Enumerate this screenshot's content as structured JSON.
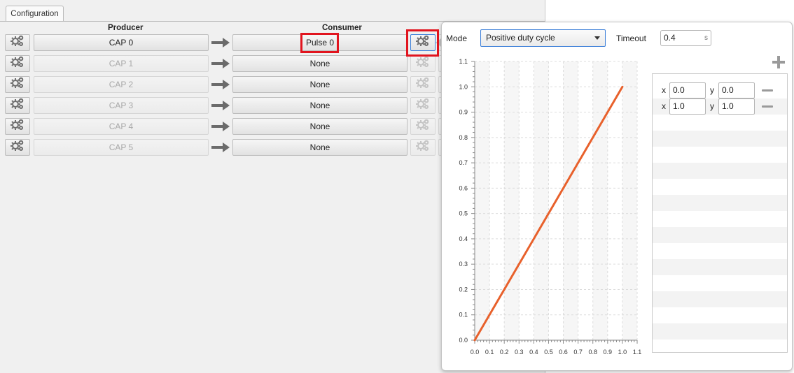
{
  "tab": {
    "label": "Configuration"
  },
  "headers": {
    "producer": "Producer",
    "consumer": "Consumer"
  },
  "rows": [
    {
      "producer": "CAP 0",
      "consumer": "Pulse 0",
      "producer_enabled": true
    },
    {
      "producer": "CAP 1",
      "consumer": "None",
      "producer_enabled": false
    },
    {
      "producer": "CAP 2",
      "consumer": "None",
      "producer_enabled": false
    },
    {
      "producer": "CAP 3",
      "consumer": "None",
      "producer_enabled": false
    },
    {
      "producer": "CAP 4",
      "consumer": "None",
      "producer_enabled": false
    },
    {
      "producer": "CAP 5",
      "consumer": "None",
      "producer_enabled": false
    }
  ],
  "popup": {
    "mode_label": "Mode",
    "mode_value": "Positive duty cycle",
    "timeout_label": "Timeout",
    "timeout_value": "0.4",
    "timeout_unit": "s",
    "points": [
      {
        "x_label": "x",
        "x": "0.0",
        "y_label": "y",
        "y": "0.0"
      },
      {
        "x_label": "x",
        "x": "1.0",
        "y_label": "y",
        "y": "1.0"
      }
    ]
  },
  "chart_data": {
    "type": "line",
    "x": [
      0.0,
      1.0
    ],
    "series": [
      {
        "values": [
          0.0,
          1.0
        ],
        "color": "#e8612c"
      }
    ],
    "xlim": [
      0.0,
      1.1
    ],
    "ylim": [
      0.0,
      1.1
    ],
    "xticks": [
      "0.0",
      "0.1",
      "0.2",
      "0.3",
      "0.4",
      "0.5",
      "0.6",
      "0.7",
      "0.8",
      "0.9",
      "1.0",
      "1.1"
    ],
    "yticks": [
      "0.0",
      "0.1",
      "0.2",
      "0.3",
      "0.4",
      "0.5",
      "0.6",
      "0.7",
      "0.8",
      "0.9",
      "1.0",
      "1.1"
    ],
    "grid": true
  },
  "colors": {
    "highlight": "#e1141e",
    "line": "#e8612c",
    "select_border": "#3c7fd8"
  }
}
